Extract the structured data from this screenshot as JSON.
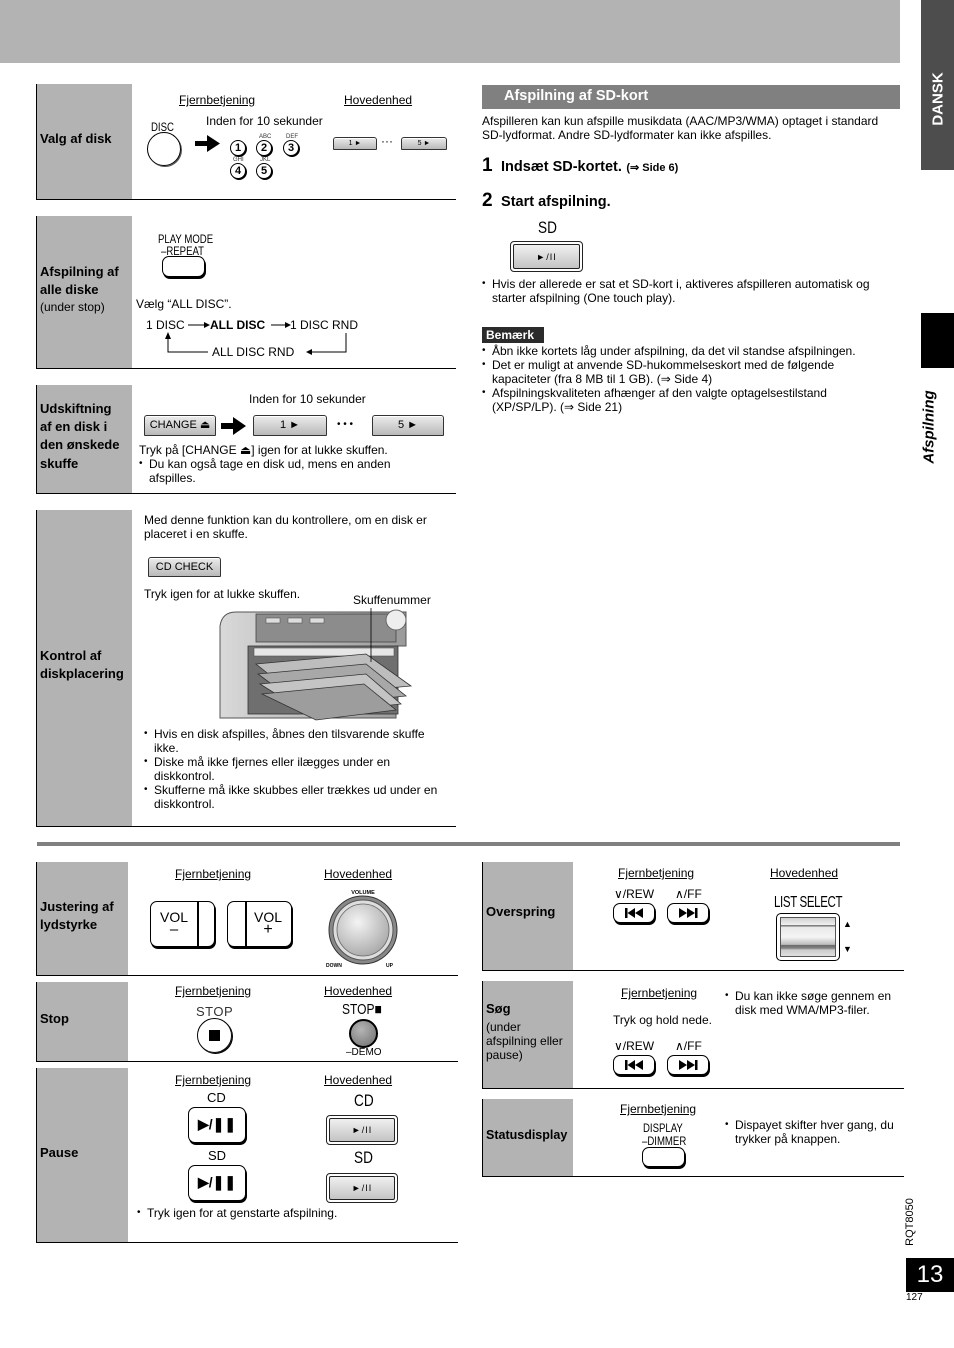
{
  "header": {
    "language_tab": "DANSK",
    "section_tab": "Afspilning"
  },
  "labels": {
    "remote": "Fjernbetjening",
    "main_unit": "Hovedenhed",
    "within_10s": "Inden for 10 sekunder"
  },
  "disc_select": {
    "title": "Valg af disk",
    "disc_button": "DISC",
    "keys": [
      {
        "num": "1",
        "letters": ""
      },
      {
        "num": "2",
        "letters": "ABC"
      },
      {
        "num": "3",
        "letters": "DEF"
      },
      {
        "num": "4",
        "letters": "GHI"
      },
      {
        "num": "5",
        "letters": "JKL"
      }
    ],
    "main_first": "1 ►",
    "main_last": "5 ►",
    "ellipsis": "···"
  },
  "all_discs": {
    "title_lines": [
      "Afspilning af",
      "alle diske"
    ],
    "subtitle": "(under stop)",
    "button_top": "PLAY MODE",
    "button_bottom": "–REPEAT",
    "instruction": "Vælg “ALL DISC”.",
    "modes": [
      "1 DISC",
      "ALL DISC",
      "1 DISC RND",
      "ALL DISC RND"
    ]
  },
  "change_disc": {
    "title_lines": [
      "Udskiftning",
      "af en disk i",
      "den ønskede",
      "skuffe"
    ],
    "change_button": "CHANGE ⏏",
    "tray_first": "1 ►",
    "tray_last": "5 ►",
    "ellipsis": "•  •  •",
    "instruction": "Tryk på [CHANGE ⏏] igen for at lukke skuffen.",
    "bullets": [
      "Du kan også tage en disk ud, mens en anden afspilles."
    ]
  },
  "disc_check": {
    "title_lines": [
      "Kontrol af",
      "diskplacering"
    ],
    "intro": "Med denne funktion kan du kontrollere, om en disk er placeret i en skuffe.",
    "button": "CD CHECK",
    "close_hint": "Tryk igen for at lukke skuffen.",
    "callout": "Skuffenummer",
    "bullets": [
      "Hvis en disk afspilles, åbnes den tilsvarende skuffe ikke.",
      "Diske må ikke fjernes eller ilægges under en diskkontrol.",
      "Skufferne må ikke skubbes eller trækkes ud under en diskkontrol."
    ]
  },
  "sd_playback": {
    "heading": "Afspilning af SD-kort",
    "intro": "Afspilleren kan kun afspille musikdata (AAC/MP3/WMA) optaget i standard SD-lydformat. Andre SD-lydformater kan ikke afspilles.",
    "steps": [
      {
        "num": "1",
        "text": "Indsæt SD-kortet.",
        "ref": "(⇒ Side 6)"
      },
      {
        "num": "2",
        "text": "Start afspilning.",
        "ref": ""
      }
    ],
    "button_caption": "SD",
    "button_label": "►/II",
    "bullets": [
      "Hvis der allerede er sat et SD-kort i, aktiveres afspilleren automatisk og starter afspilning (One touch play)."
    ],
    "note_badge": "Bemærk",
    "notes": [
      "Åbn ikke kortets låg under afspilning, da det vil standse afspilningen.",
      "Det er muligt at anvende SD-hukommelseskort med de følgende kapaciteter (fra 8 MB til 1 GB). (⇒ Side 4)",
      "Afspilningskvaliteten afhænger af den valgte optagelsestilstand (XP/SP/LP). (⇒ Side 21)"
    ]
  },
  "volume": {
    "title_lines": [
      "Justering af",
      "lydstyrke"
    ],
    "vol_text": "VOL",
    "minus": "–",
    "plus": "+",
    "knob_label": "VOLUME",
    "knob_down": "DOWN",
    "knob_up": "UP"
  },
  "stop": {
    "title": "Stop",
    "remote_caption": "STOP",
    "main_caption": "STOP■",
    "main_sub": "–DEMO"
  },
  "pause": {
    "title": "Pause",
    "cd_caption": "CD",
    "sd_caption": "SD",
    "remote_label": "▶/❚❚",
    "main_label": "►/II",
    "bullets": [
      "Tryk igen for at genstarte afspilning."
    ]
  },
  "skip": {
    "title": "Overspring",
    "rew_caption": "∨/REW",
    "ff_caption": "∧/FF",
    "list_select": "LIST SELECT",
    "up_arrow": "▲",
    "down_arrow": "▼"
  },
  "search": {
    "title": "Søg",
    "subtitle_lines": [
      "(under",
      "afspilning eller",
      "pause)"
    ],
    "hint": "Tryk og hold nede.",
    "rew_caption": "∨/REW",
    "ff_caption": "∧/FF",
    "bullets": [
      "Du kan ikke søge gennem en disk med WMA/MP3-filer."
    ]
  },
  "status": {
    "title": "Statusdisplay",
    "button_top": "DISPLAY",
    "button_bottom": "–DIMMER",
    "bullets": [
      "Dispayet skifter hver gang, du trykker på knappen."
    ]
  },
  "footer": {
    "doc_code": "RQT8050",
    "page_number": "13",
    "sub_page_number": "127"
  }
}
